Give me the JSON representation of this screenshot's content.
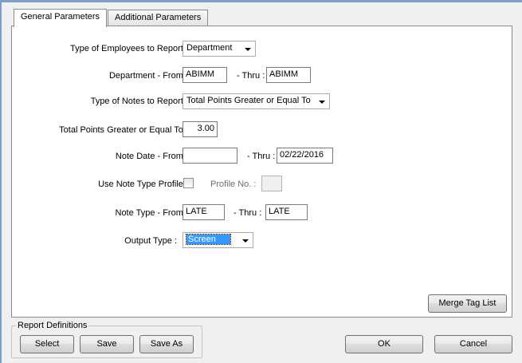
{
  "tabs": [
    {
      "label": "General Parameters",
      "active": true
    },
    {
      "label": "Additional Parameters",
      "active": false
    }
  ],
  "form": {
    "employee_type_label": "Type of Employees to Report :",
    "employee_type_value": "Department",
    "department_from_label": "Department - From :",
    "department_from_value": "ABIMM",
    "department_thru_label": "- Thru :",
    "department_thru_value": "ABIMM",
    "notes_type_label": "Type of Notes to Report :",
    "notes_type_value": "Total Points Greater or Equal To",
    "total_points_label": "Total Points Greater or Equal To :",
    "total_points_value": "3.00",
    "note_date_from_label": "Note Date - From :",
    "note_date_from_value": "",
    "note_date_thru_label": "- Thru :",
    "note_date_thru_value": "02/22/2016",
    "use_profile_label": "Use Note Type Profile :",
    "use_profile_checked": false,
    "profile_no_label": "Profile No. :",
    "profile_no_value": "",
    "note_type_from_label": "Note Type - From :",
    "note_type_from_value": "LATE",
    "note_type_thru_label": "- Thru :",
    "note_type_thru_value": "LATE",
    "output_type_label": "Output Type :",
    "output_type_value": "Screen"
  },
  "merge_tag_list_label": "Merge Tag List",
  "report_definitions": {
    "title": "Report Definitions",
    "select_label": "Select",
    "save_label": "Save",
    "save_as_label": "Save As"
  },
  "ok_label": "OK",
  "cancel_label": "Cancel"
}
